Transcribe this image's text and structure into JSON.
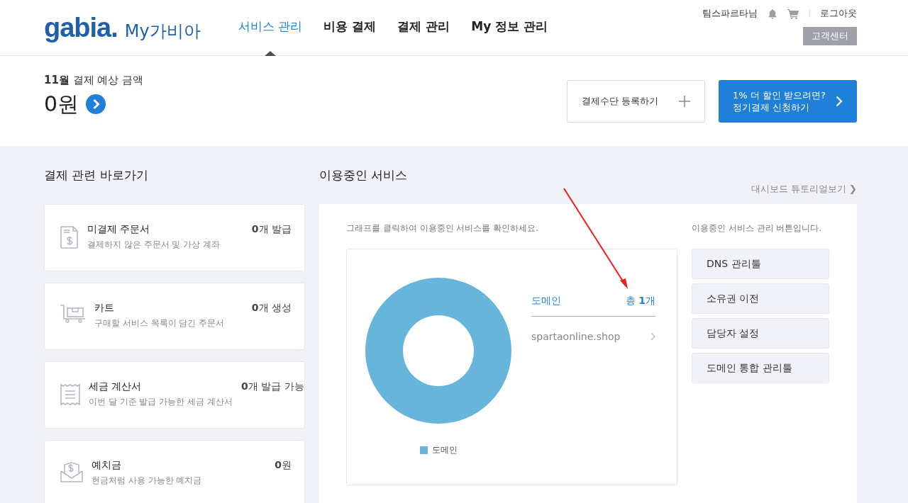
{
  "header": {
    "logo": "gabia.",
    "site_title": "My가비아",
    "nav": [
      {
        "label": "서비스 관리",
        "selected": true
      },
      {
        "label": "비용 결제",
        "selected": false
      },
      {
        "label": "결제 관리",
        "selected": false
      },
      {
        "label": "My 정보 관리",
        "selected": false
      }
    ],
    "user_name": "팀스파르타님",
    "logout": "로그아웃",
    "support_button": "고객센터"
  },
  "summary": {
    "label": "**11월** 결제 예상 금액",
    "amount": "0원",
    "register_button": "결제수단 등록하기",
    "promo_button": [
      "1% 더 할인 받으려면?",
      "정기결제 신청하기"
    ]
  },
  "shortcuts": {
    "title": "결제 관련 바로가기",
    "cards": [
      {
        "kind": "invoice",
        "title": "미결제 주문서",
        "description": "결제하지 않은 주문서 및 가상 계좌",
        "value": "**0**개 발급"
      },
      {
        "kind": "cart",
        "title": "카트",
        "description": "구매할 서비스 목록이 담긴 주문서",
        "value": "**0**개 생성"
      },
      {
        "kind": "receipt",
        "title": "세금 계산서",
        "description": "이번 달 기준 발급 가능한 세금 계산서",
        "value": "**0**개 발급 가능"
      },
      {
        "kind": "deposit",
        "title": "예치금",
        "description": "현금처럼 사용 가능한 예치금",
        "value": "**0**원"
      }
    ]
  },
  "services": {
    "title": "이용중인 서비스",
    "tutorial_link": "대시보드 튜토리얼보기 ❯",
    "chart_hint": "그래프를 클릭하여 이용중인 서비스를 확인하세요.",
    "chart_legend": "도메인",
    "list_title": "도메인",
    "list_total": "총 **1**개",
    "list_items": [
      "spartaonline.shop"
    ],
    "manage_hint": "이용중인 서비스 관리 버튼입니다.",
    "manage_buttons": [
      "DNS 관리툴",
      "소유권 이전",
      "담당자 설정",
      "도메인 통합 관리툴"
    ]
  }
}
